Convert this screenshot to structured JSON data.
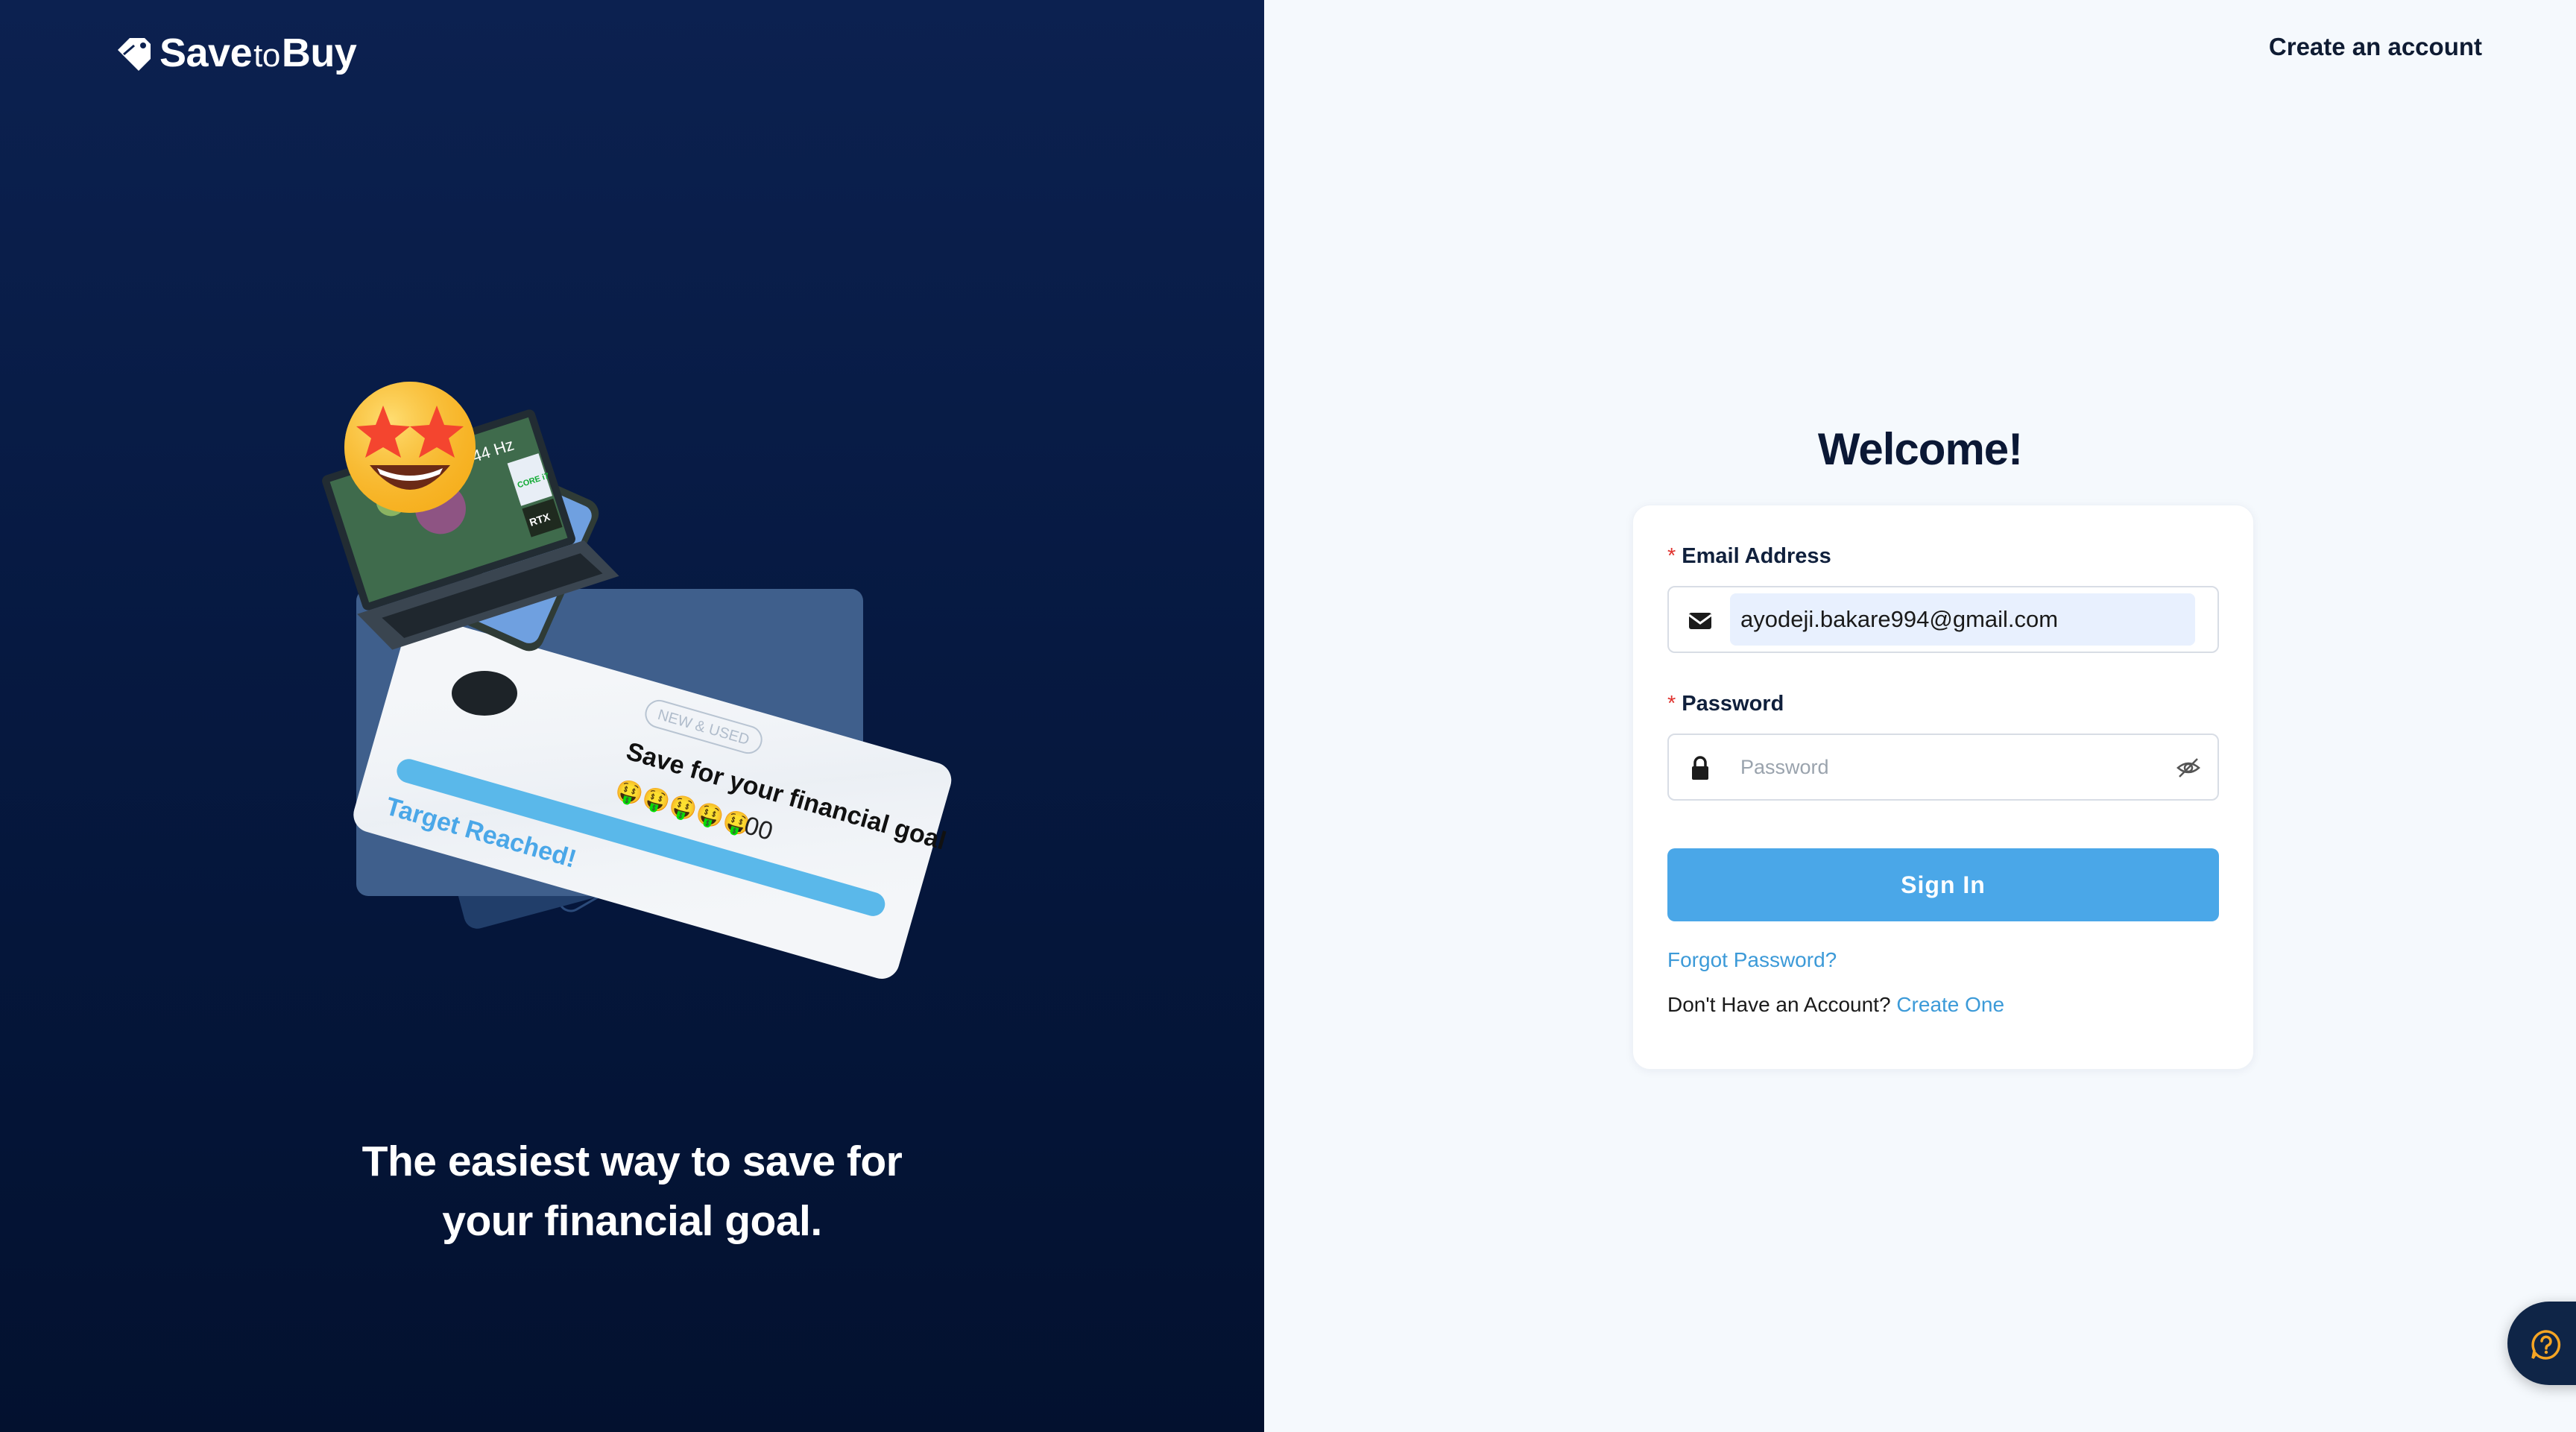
{
  "brand": {
    "name_save": "Save",
    "name_to": "to",
    "name_buy": "Buy"
  },
  "header": {
    "create_account_link": "Create an account"
  },
  "hero": {
    "tagline_line1": "The easiest way to save for",
    "tagline_line2": "your financial goal.",
    "card_badge": "NEW & USED",
    "card_title": "Save for your financial goal",
    "card_amount_emojis": "🤑🤑🤑🤑🤑",
    "card_amount_suffix": ".00",
    "card_status": "Target Reached!",
    "laptop_refresh": "144 Hz",
    "sticker_intel": "CORE i7",
    "sticker_rtx": "RTX"
  },
  "form": {
    "title": "Welcome!",
    "email_label": "Email Address",
    "email_value": "ayodeji.bakare994@gmail.com",
    "password_label": "Password",
    "password_placeholder": "Password",
    "required_marker": "*",
    "submit_label": "Sign In",
    "forgot_link": "Forgot Password?",
    "no_account_text": "Don't Have an Account?",
    "create_link": "Create One"
  },
  "icons": {
    "brand": "tag-logo-icon",
    "email": "envelope-icon",
    "password": "lock-icon",
    "visibility": "eye-off-icon",
    "help": "question-help-icon"
  },
  "colors": {
    "hero_bg": "#061941",
    "primary_button": "#4aa7e8",
    "link": "#3c9ad8",
    "required": "#e0332f",
    "email_autofill": "#e8f0fe",
    "help_bubble": "#0f2547",
    "help_icon": "#f5a524"
  }
}
